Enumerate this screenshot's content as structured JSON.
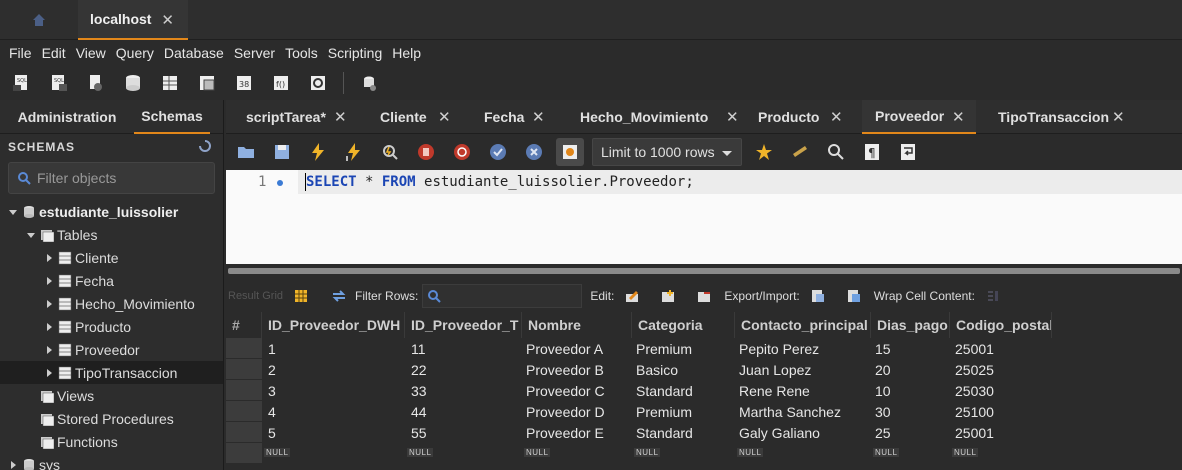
{
  "connection_tab": {
    "label": "localhost",
    "close": "✕"
  },
  "menu": [
    "File",
    "Edit",
    "View",
    "Query",
    "Database",
    "Server",
    "Tools",
    "Scripting",
    "Help"
  ],
  "sidebar": {
    "tabs": [
      "Administration",
      "Schemas"
    ],
    "header": "SCHEMAS",
    "filter_placeholder": "Filter objects",
    "schema": "estudiante_luissolier",
    "tables_label": "Tables",
    "tables": [
      "Cliente",
      "Fecha",
      "Hecho_Movimiento",
      "Producto",
      "Proveedor",
      "TipoTransaccion"
    ],
    "views_label": "Views",
    "procedures_label": "Stored Procedures",
    "functions_label": "Functions",
    "sys_label": "sys"
  },
  "editor_tabs": [
    "scriptTarea*",
    "Cliente",
    "Fecha",
    "Hecho_Movimiento",
    "Producto",
    "Proveedor",
    "TipoTransaccion"
  ],
  "active_editor_tab": "Proveedor",
  "tab_close": "✕",
  "limit_select": "Limit to 1000 rows",
  "editor": {
    "line_number": "1",
    "kw_select": "SELECT",
    "star": " * ",
    "kw_from": "FROM",
    "target": " estudiante_luissolier.Proveedor;"
  },
  "result_toolbar": {
    "result_grid": "Result Grid",
    "filter_rows": "Filter Rows:",
    "edit": "Edit:",
    "export_import": "Export/Import:",
    "wrap": "Wrap Cell Content:"
  },
  "grid": {
    "headers": [
      "#",
      "ID_Proveedor_DWH",
      "ID_Proveedor_T",
      "Nombre",
      "Categoria",
      "Contacto_principal",
      "Dias_pago",
      "Codigo_postal"
    ],
    "rows": [
      [
        "1",
        "11",
        "Proveedor A",
        "Premium",
        "Pepito Perez",
        "15",
        "25001"
      ],
      [
        "2",
        "22",
        "Proveedor B",
        "Basico",
        "Juan Lopez",
        "20",
        "25025"
      ],
      [
        "3",
        "33",
        "Proveedor C",
        "Standard",
        "Rene Rene",
        "10",
        "25030"
      ],
      [
        "4",
        "44",
        "Proveedor D",
        "Premium",
        "Martha Sanchez",
        "30",
        "25100"
      ],
      [
        "5",
        "55",
        "Proveedor E",
        "Standard",
        "Galy Galiano",
        "25",
        "25001"
      ]
    ],
    "null_label": "NULL"
  },
  "colors": {
    "accent": "#e2871a",
    "keyword": "#1c46b4"
  }
}
